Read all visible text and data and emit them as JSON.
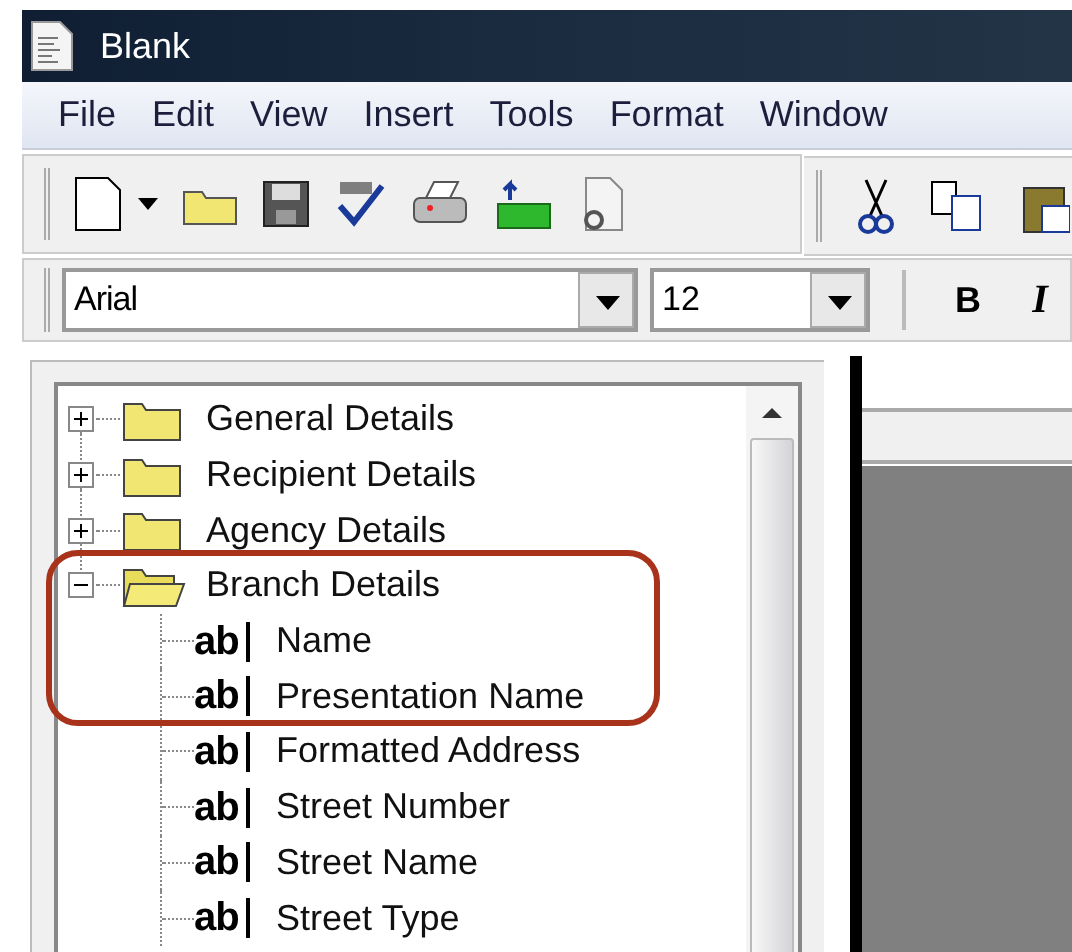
{
  "window": {
    "title": "Blank"
  },
  "menu": [
    "File",
    "Edit",
    "View",
    "Insert",
    "Tools",
    "Format",
    "Window"
  ],
  "format_bar": {
    "font": "Arial",
    "size": "12",
    "bold": "B",
    "italic": "I"
  },
  "tree": [
    {
      "label": "General Details",
      "expanded": false
    },
    {
      "label": "Recipient Details",
      "expanded": false
    },
    {
      "label": "Agency Details",
      "expanded": false
    },
    {
      "label": "Branch Details",
      "expanded": true,
      "children": [
        {
          "glyph": "ab",
          "label": "Name"
        },
        {
          "glyph": "ab",
          "label": "Presentation Name"
        },
        {
          "glyph": "ab",
          "label": "Formatted Address"
        },
        {
          "glyph": "ab",
          "label": "Street Number"
        },
        {
          "glyph": "ab",
          "label": "Street Name"
        },
        {
          "glyph": "ab",
          "label": "Street Type"
        }
      ]
    }
  ]
}
